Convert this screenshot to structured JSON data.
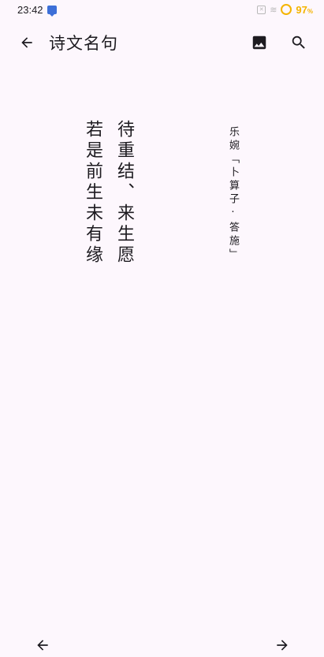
{
  "status_bar": {
    "time": "23:42",
    "battery_percent": "97",
    "battery_unit": "%",
    "sim_glyph": "✕",
    "wifi_glyph": "≋"
  },
  "app_bar": {
    "title": "诗文名句",
    "back_icon": "arrow-back-icon",
    "image_icon": "image-icon",
    "search_icon": "search-icon"
  },
  "poem": {
    "lines": [
      "待重结、来生愿",
      "若是前生未有缘"
    ],
    "attribution": "乐婉「卜算子·答施」"
  },
  "bottom_nav": {
    "prev_icon": "arrow-left-icon",
    "next_icon": "arrow-right-icon"
  },
  "colors": {
    "background": "#fdf7fd",
    "text": "#1d1b20",
    "battery": "#f4b400",
    "notification": "#3d6fd8"
  }
}
